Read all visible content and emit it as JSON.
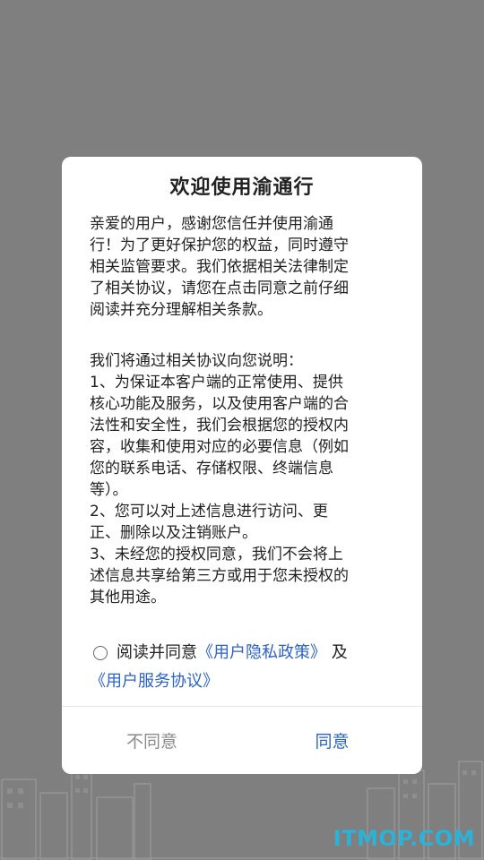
{
  "dialog": {
    "title": "欢迎使用渝通行",
    "intro": "亲爱的用户，感谢您信任并使用渝通\n行！为了更好保护您的权益，同时遵守\n相关监管要求。我们依据相关法律制定\n了相关协议，请您在点击同意之前仔细\n阅读并充分理解相关条款。",
    "details": "我们将通过相关协议向您说明：\n1、为保证本客户端的正常使用、提供\n核心功能及服务，以及使用客户端的合\n法性和安全性，我们会根据您的授权内\n容，收集和使用对应的必要信息（例如\n您的联系电话、存储权限、终端信息\n等）。\n2、您可以对上述信息进行访问、更\n正、删除以及注销账户。\n3、未经您的授权同意，我们不会将上\n述信息共享给第三方或用于您未授权的\n其他用途。",
    "consent": {
      "prefix": "阅读并同意",
      "privacy_link": "《用户隐私政策》",
      "and": " 及",
      "service_link": "《用户服务协议》",
      "checked": false
    },
    "buttons": {
      "disagree": "不同意",
      "agree": "同意"
    }
  },
  "watermark": "ITMOP.COM",
  "colors": {
    "overlay": "#7f7f7f",
    "link": "#2a63c7",
    "watermark": "#2bb2d6"
  }
}
